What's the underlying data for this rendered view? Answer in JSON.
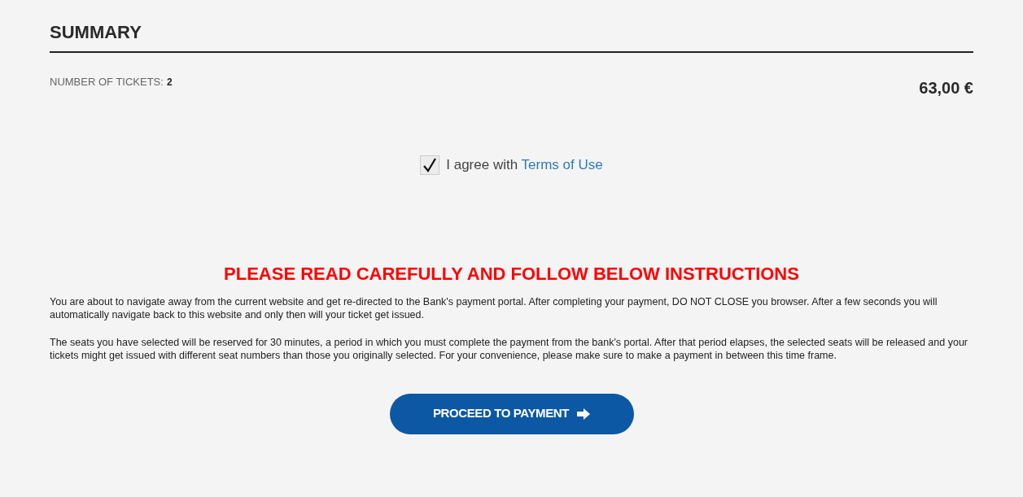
{
  "summary": {
    "title": "SUMMARY",
    "tickets_label": "NUMBER OF TICKETS:",
    "tickets_count": "2",
    "total": "63,00 €"
  },
  "agreement": {
    "checked": true,
    "text": "I agree with",
    "link": "Terms of Use"
  },
  "instructions": {
    "heading": "PLEASE READ CAREFULLY AND FOLLOW BELOW INSTRUCTIONS",
    "paragraphs": [
      "You are about to navigate away from the current website and get re-directed to the Bank's payment portal. After completing your payment, DO NOT CLOSE you browser. After a few seconds you will automatically navigate back to this website and only then will your ticket get issued.",
      "The seats you have selected will be reserved for 30 minutes, a period in which you must complete the payment from the bank's portal. After that period elapses, the selected seats will be released and your tickets might get issued with different seat numbers than those you originally selected. For your convenience, please make sure to make a payment in between this time frame."
    ]
  },
  "button": {
    "label": "PROCEED TO PAYMENT"
  }
}
